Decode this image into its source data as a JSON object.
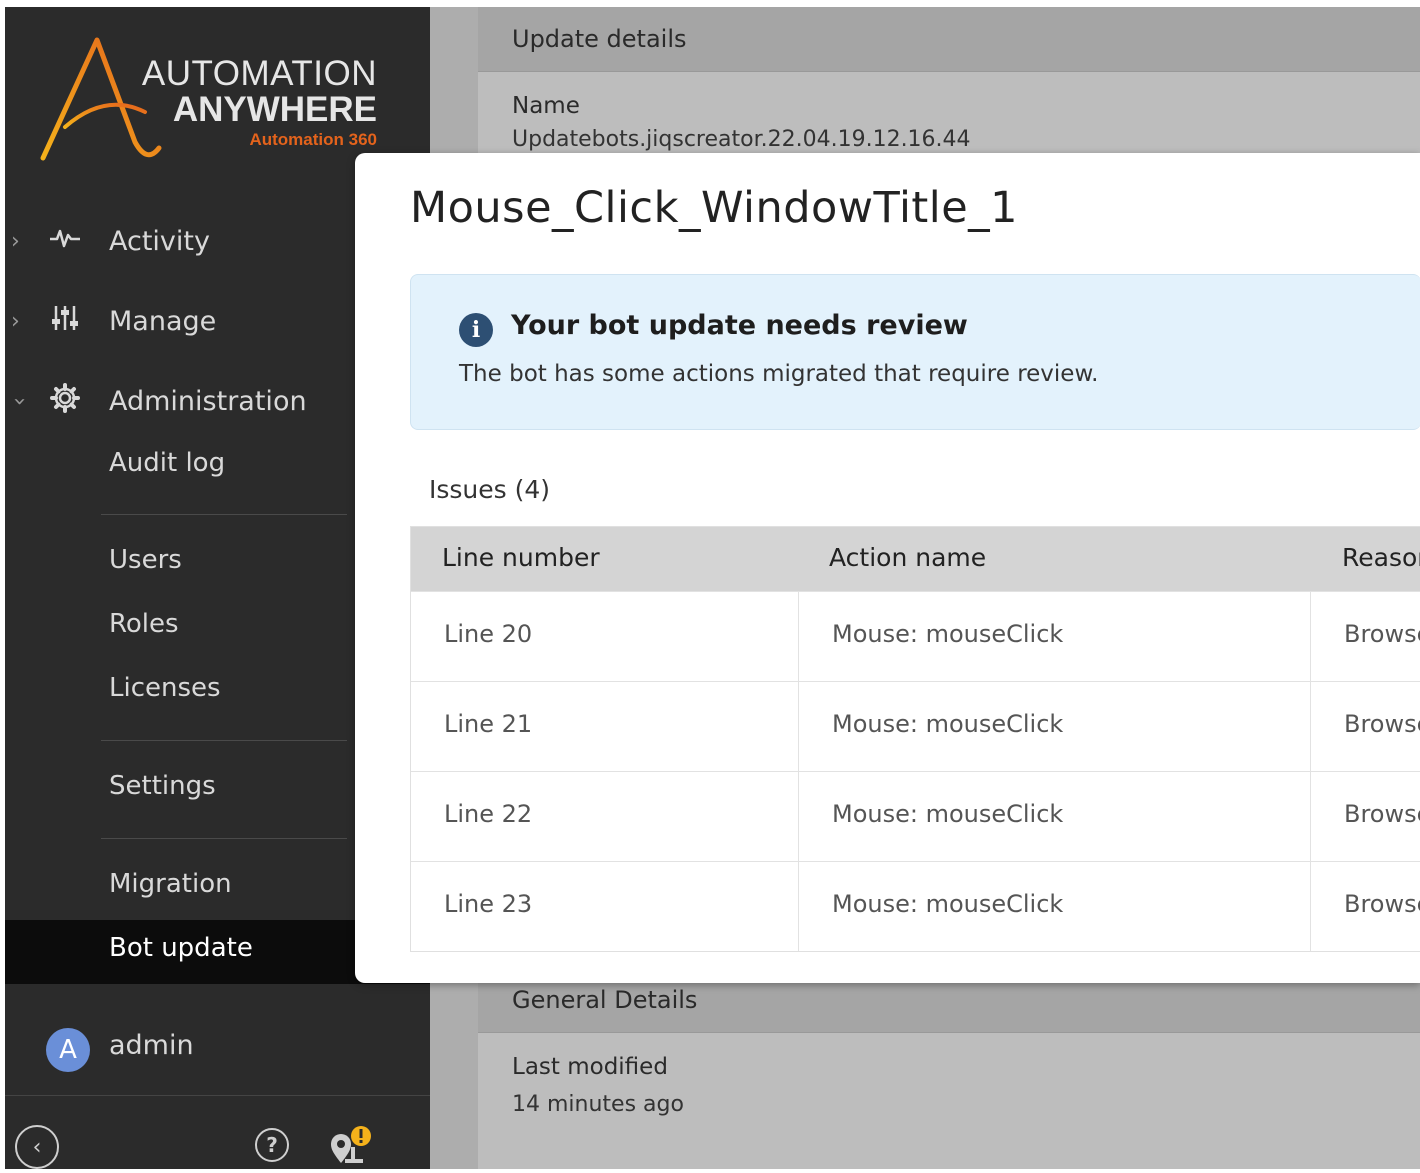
{
  "brand": {
    "line1": "AUTOMATION",
    "line2": "ANYWHERE",
    "line3": "Automation 360",
    "colors": {
      "logo_gradient_start": "#f5b21b",
      "logo_gradient_end": "#e4631c"
    }
  },
  "sidebar": {
    "nav": [
      {
        "label": "Activity",
        "icon": "activity-pulse-icon",
        "chevron": "chevron-right-icon"
      },
      {
        "label": "Manage",
        "icon": "sliders-icon",
        "chevron": "chevron-right-icon"
      },
      {
        "label": "Administration",
        "icon": "gear-icon",
        "chevron": "chevron-down-icon"
      }
    ],
    "admin_items": [
      "Audit log",
      "Users",
      "Roles",
      "Licenses",
      "Settings",
      "Migration",
      "Bot update"
    ],
    "active_item": "Bot update",
    "user": {
      "initial": "A",
      "name": "admin"
    },
    "footer_icons": [
      "collapse-sidebar-icon",
      "help-icon",
      "notifications-icon"
    ]
  },
  "background_page": {
    "section1_title": "Update details",
    "name_label": "Name",
    "name_value": "Updatebots.jiqscreator.22.04.19.12.16.44",
    "section2_title": "General Details",
    "last_modified_label": "Last modified",
    "last_modified_value": "14 minutes ago"
  },
  "modal": {
    "title": "Mouse_Click_WindowTitle_1",
    "alert": {
      "icon": "info-icon",
      "title": "Your bot update needs review",
      "text": "The bot has some actions migrated that require review."
    },
    "issues_label": "Issues",
    "issues_count": "(4)",
    "table": {
      "headers": [
        "Line number",
        "Action name",
        "Reason"
      ],
      "rows": [
        [
          "Line 20",
          "Mouse: mouseClick",
          "Browser"
        ],
        [
          "Line 21",
          "Mouse: mouseClick",
          "Browser"
        ],
        [
          "Line 22",
          "Mouse: mouseClick",
          "Browser"
        ],
        [
          "Line 23",
          "Mouse: mouseClick",
          "Browser"
        ]
      ]
    }
  }
}
